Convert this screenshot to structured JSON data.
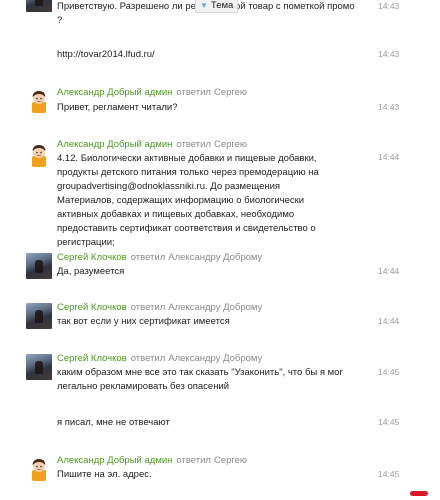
{
  "messages": [
    {
      "text": "Приветствую. Разрешено ли рекла    ь такой товар с пометкой промо ?",
      "time": "14:43"
    },
    {
      "text": "http://tovar2014.lfud.ru/",
      "time": "14:43"
    },
    {
      "author": "Александр Добрый админ",
      "replied": "ответил",
      "target": "Сергею",
      "text": "Привет, регламент читали?",
      "time": "14:43"
    },
    {
      "author": "Александр Добрый админ",
      "replied": "ответил",
      "target": "Сергею",
      "text": "4.12.        Биологически активные добавки и пищевые добавки, продукты детского питания только через премодерацию на groupadvertising@odnoklassniki.ru. До размещения Материалов, содержащих информацию о биологически активных добавках и пищевых добавках, необходимо предоставить сертификат соответствия и свидетельство о регистрации;",
      "time": "14:44"
    },
    {
      "author": "Сергей Клочков",
      "replied": "ответил",
      "target": "Александру Доброму",
      "text": "Да, разумеется",
      "time": "14:44"
    },
    {
      "author": "Сергей Клочков",
      "replied": "ответил",
      "target": "Александру Доброму",
      "text": "так вот если у них сертификат имеется",
      "time": "14:44"
    },
    {
      "author": "Сергей Клочков",
      "replied": "ответил",
      "target": "Александру Доброму",
      "text": "каким образом мне все это так сказать \"Узаконить\", что бы я мог легально рекламировать без опасений",
      "time": "14:45"
    },
    {
      "text": "я писал, мне не отвечают",
      "time": "14:45"
    },
    {
      "author": "Александр Добрый админ",
      "replied": "ответил",
      "target": "Сергею",
      "text": "Пишите на эл. адрес.",
      "time": "14:45"
    }
  ],
  "tooltip": {
    "label": "Тема",
    "arrow_icon": "triangle-down-icon"
  },
  "colors": {
    "author": "#4a9a1f",
    "meta": "#8a8a8a",
    "accent": "#d9182a"
  }
}
